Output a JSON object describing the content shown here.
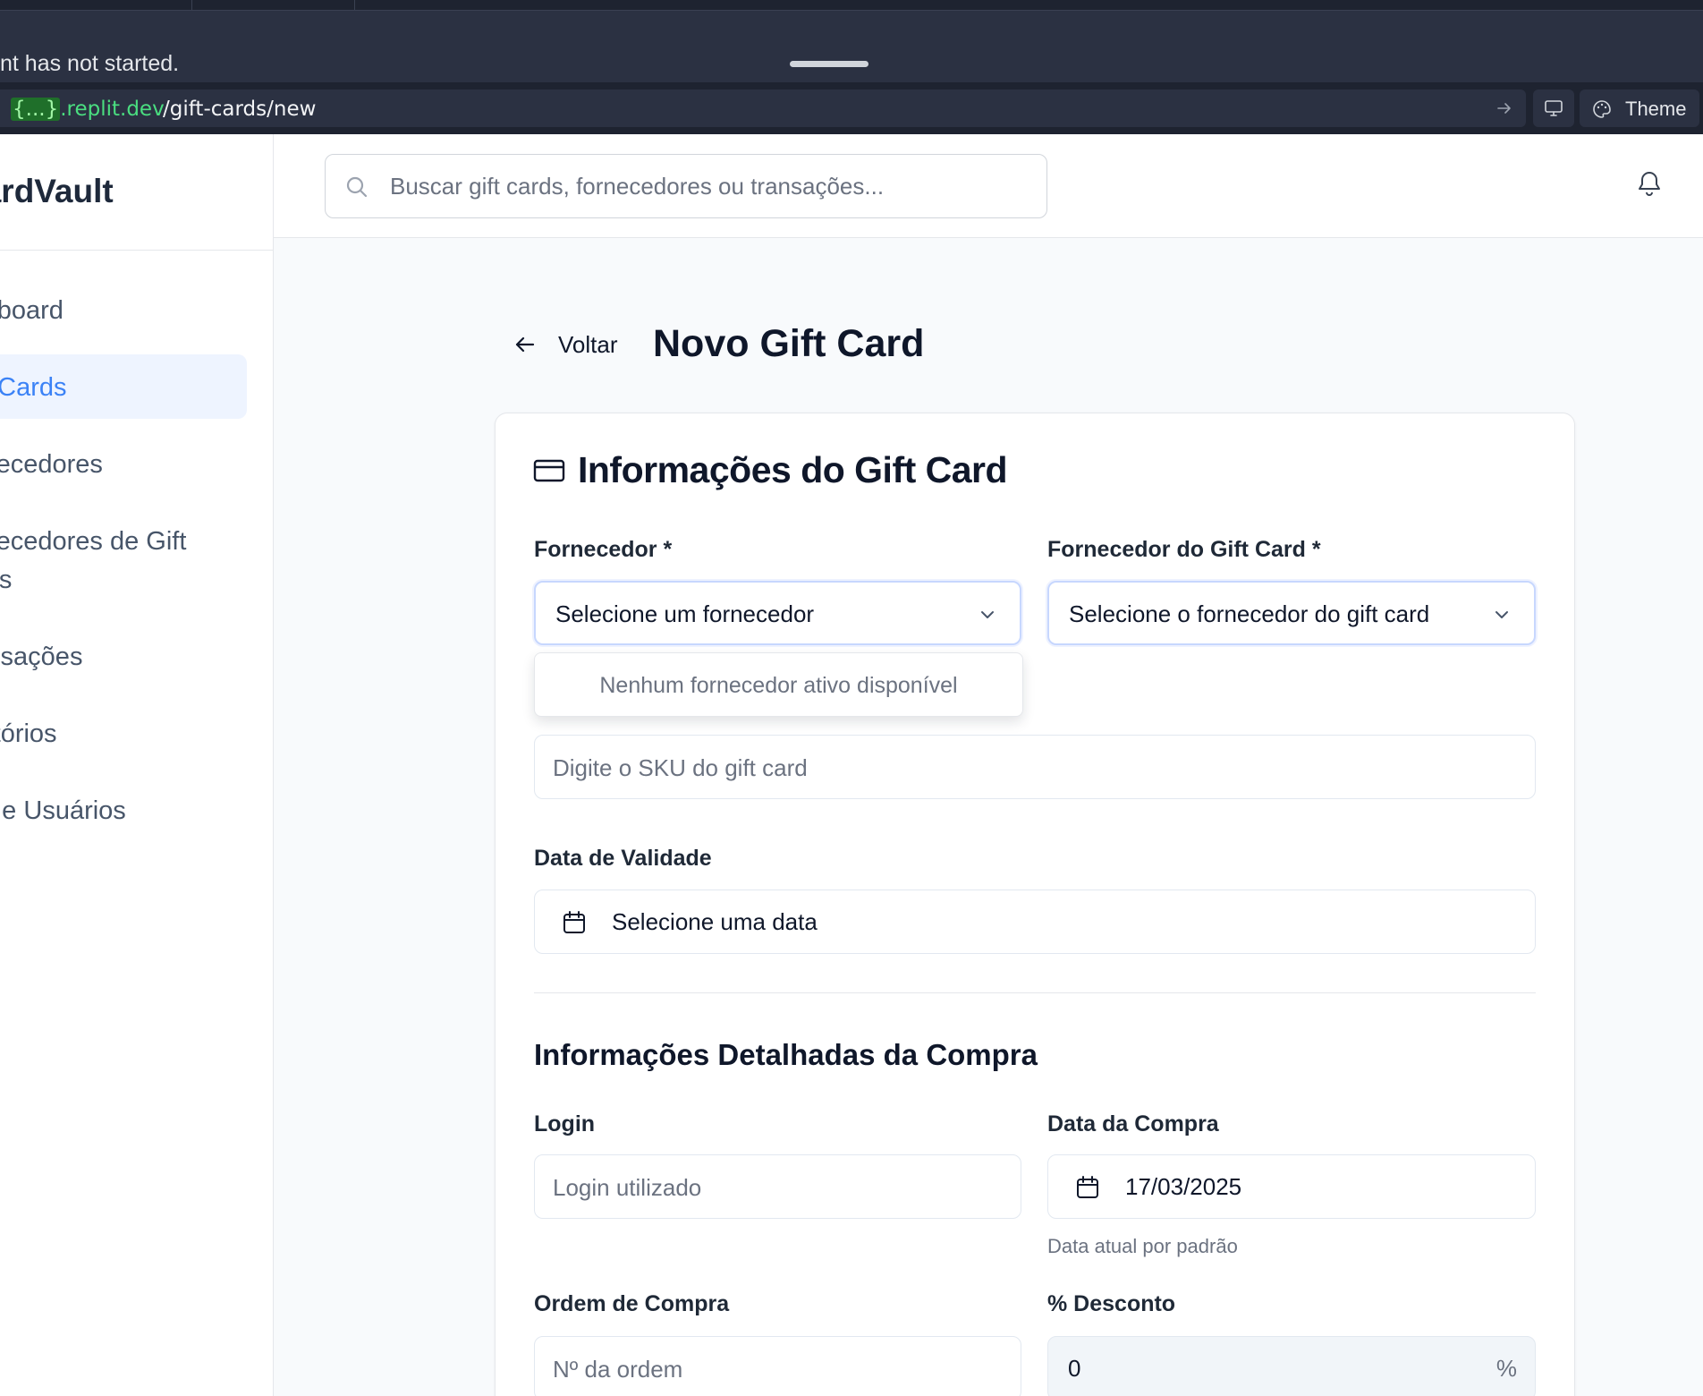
{
  "browser": {
    "notice": "nt has not started.",
    "url_host_prefix": "{...}",
    "url_host_suffix": ".replit.dev",
    "url_path": "/gift-cards/new",
    "theme_label": "Theme"
  },
  "sidebar": {
    "brand": "CardVault",
    "items": [
      {
        "label": "Dashboard"
      },
      {
        "label": "Gift Cards"
      },
      {
        "label": "Fornecedores"
      },
      {
        "label": "Fornecedores de Gift"
      },
      {
        "label": "Cards"
      },
      {
        "label": "Transações"
      },
      {
        "label": "Relatórios"
      },
      {
        "label": "Perfis e Usuários"
      }
    ]
  },
  "header": {
    "search_placeholder": "Buscar gift cards, fornecedores ou transações..."
  },
  "page": {
    "back_label": "Voltar",
    "title": "Novo Gift Card"
  },
  "card": {
    "title": "Informações do Gift Card",
    "supplier_label": "Fornecedor *",
    "supplier_value": "Selecione um fornecedor",
    "supplier_empty": "Nenhum fornecedor ativo disponível",
    "gc_supplier_label": "Fornecedor do Gift Card *",
    "gc_supplier_value": "Selecione o fornecedor do gift card",
    "sku_placeholder": "Digite o SKU do gift card",
    "expiry_label": "Data de Validade",
    "expiry_value": "Selecione uma data",
    "section2_title": "Informações Detalhadas da Compra",
    "login_label": "Login",
    "login_placeholder": "Login utilizado",
    "purchase_date_label": "Data da Compra",
    "purchase_date_value": "17/03/2025",
    "purchase_date_hint": "Data atual por padrão",
    "order_label": "Ordem de Compra",
    "order_placeholder": "Nº da ordem",
    "discount_label": "% Desconto",
    "discount_value": "0",
    "discount_unit": "%"
  },
  "colors": {
    "accent": "#3b82f6",
    "active_bg": "#eef4ff",
    "chrome_bg": "#1e2330"
  }
}
